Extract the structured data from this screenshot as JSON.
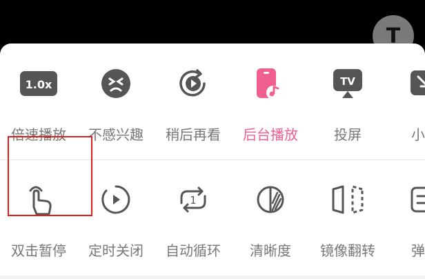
{
  "accent_color": "#f15f8f",
  "highlight_color": "#e01c1c",
  "top_right_icon": "text-t-icon",
  "row1": [
    {
      "label": "倍速播放",
      "icon": "speed-icon",
      "badge": "1.0x"
    },
    {
      "label": "不感兴趣",
      "icon": "dislike-face-icon"
    },
    {
      "label": "稍后再看",
      "icon": "watch-later-icon"
    },
    {
      "label": "后台播放",
      "icon": "background-play-icon",
      "active": true
    },
    {
      "label": "投屏",
      "icon": "tv-cast-icon",
      "badge": "TV"
    },
    {
      "label": "小窗",
      "icon": "mini-window-icon"
    }
  ],
  "row2": [
    {
      "label": "双击暂停",
      "icon": "double-tap-icon",
      "highlighted": true
    },
    {
      "label": "定时关闭",
      "icon": "timer-close-icon"
    },
    {
      "label": "自动循环",
      "icon": "loop-icon",
      "badge": "1"
    },
    {
      "label": "清晰度",
      "icon": "quality-icon"
    },
    {
      "label": "镜像翻转",
      "icon": "mirror-flip-icon"
    },
    {
      "label": "弹幕",
      "icon": "danmaku-icon"
    }
  ]
}
